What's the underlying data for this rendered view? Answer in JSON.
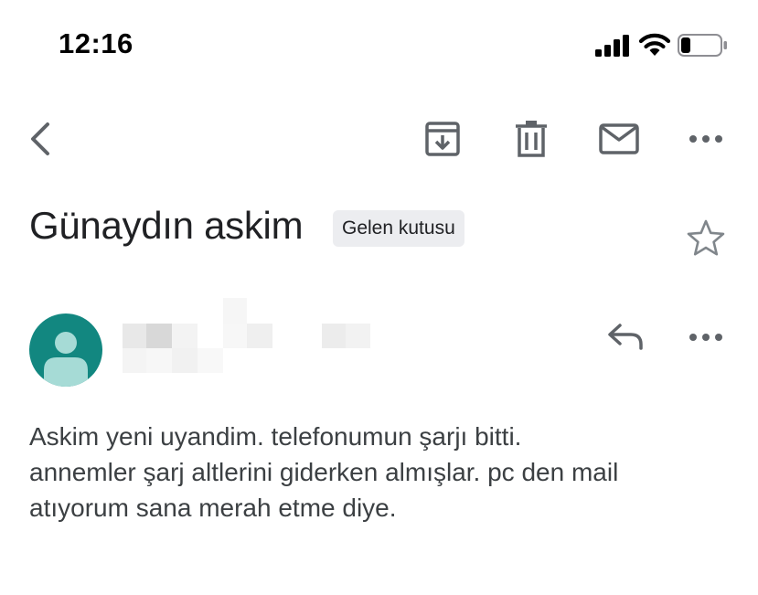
{
  "status_bar": {
    "time": "12:16",
    "signal_icon": "cellular-signal-icon",
    "wifi_icon": "wifi-icon",
    "battery_icon": "battery-icon",
    "battery_level": 0.2
  },
  "toolbar": {
    "back_icon": "chevron-left-icon",
    "archive_icon": "archive-icon",
    "delete_icon": "trash-icon",
    "mark_unread_icon": "mail-icon",
    "more_icon": "more-horizontal-icon"
  },
  "email": {
    "subject": "Günaydın askim",
    "label": "Gelen kutusu",
    "star_icon": "star-outline-icon",
    "avatar_icon": "person-avatar-icon",
    "avatar_color": "#128780",
    "reply_icon": "reply-icon",
    "more_icon": "more-horizontal-icon",
    "body_lines": [
      "Askim yeni uyandim. telefonumun şarjı bitti.",
      "annemler şarj altlerini giderken almışlar. pc den mail",
      "atıyorum sana merah etme diye."
    ]
  }
}
